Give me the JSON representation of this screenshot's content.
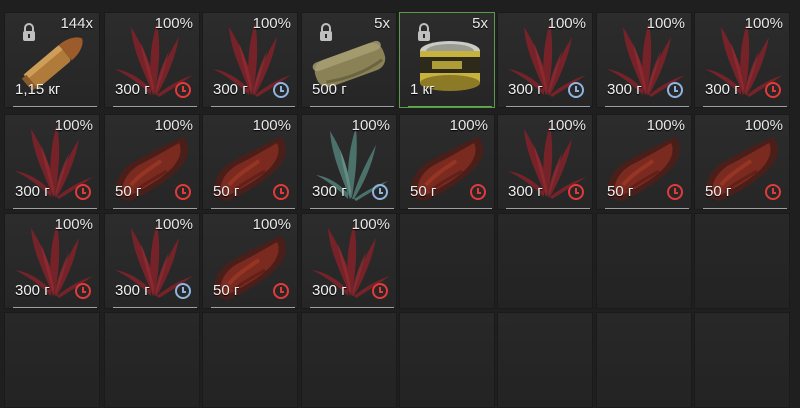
{
  "inventory": {
    "rows": [
      [
        {
          "item": "bullet",
          "count": "144x",
          "locked": true,
          "weight": "1,15 кг",
          "timer": null,
          "underline": "gray"
        },
        {
          "item": "red-plant",
          "percent": "100%",
          "weight": "300 г",
          "timer": "red",
          "underline": "gray"
        },
        {
          "item": "red-plant",
          "percent": "100%",
          "weight": "300 г",
          "timer": "blue",
          "underline": "gray"
        },
        {
          "item": "cloth-bundle",
          "count": "5x",
          "locked": true,
          "weight": "500 г",
          "timer": null,
          "underline": "gray"
        },
        {
          "item": "canned-food",
          "count": "5x",
          "locked": true,
          "weight": "1 кг",
          "timer": null,
          "underline": "green",
          "highlight": true
        },
        {
          "item": "red-plant",
          "percent": "100%",
          "weight": "300 г",
          "timer": "blue",
          "underline": "gray"
        },
        {
          "item": "red-plant",
          "percent": "100%",
          "weight": "300 г",
          "timer": "blue",
          "underline": "gray"
        },
        {
          "item": "red-plant",
          "percent": "100%",
          "weight": "300 г",
          "timer": "red",
          "underline": "gray"
        }
      ],
      [
        {
          "item": "red-plant",
          "percent": "100%",
          "weight": "300 г",
          "timer": "red",
          "underline": "gray"
        },
        {
          "item": "meat",
          "percent": "100%",
          "weight": "50 г",
          "timer": "red",
          "underline": "gray"
        },
        {
          "item": "meat",
          "percent": "100%",
          "weight": "50 г",
          "timer": "red",
          "underline": "gray"
        },
        {
          "item": "teal-plant",
          "percent": "100%",
          "weight": "300 г",
          "timer": "blue",
          "underline": "gray"
        },
        {
          "item": "meat",
          "percent": "100%",
          "weight": "50 г",
          "timer": "red",
          "underline": "gray"
        },
        {
          "item": "red-plant",
          "percent": "100%",
          "weight": "300 г",
          "timer": "red",
          "underline": "gray"
        },
        {
          "item": "meat",
          "percent": "100%",
          "weight": "50 г",
          "timer": "red",
          "underline": "gray"
        },
        {
          "item": "meat",
          "percent": "100%",
          "weight": "50 г",
          "timer": "red",
          "underline": "gray"
        }
      ],
      [
        {
          "item": "red-plant",
          "percent": "100%",
          "weight": "300 г",
          "timer": "red",
          "underline": "gray"
        },
        {
          "item": "red-plant",
          "percent": "100%",
          "weight": "300 г",
          "timer": "blue",
          "underline": "gray"
        },
        {
          "item": "meat",
          "percent": "100%",
          "weight": "50 г",
          "timer": "red",
          "underline": "gray"
        },
        {
          "item": "red-plant",
          "percent": "100%",
          "weight": "300 г",
          "timer": "red",
          "underline": "gray"
        },
        null,
        null,
        null,
        null
      ],
      [
        null,
        null,
        null,
        null,
        null,
        null,
        null,
        null
      ]
    ]
  },
  "colors": {
    "red_timer": "#e23a3a",
    "blue_timer": "#8fb4e0",
    "green_underline": "#5fae4c"
  }
}
